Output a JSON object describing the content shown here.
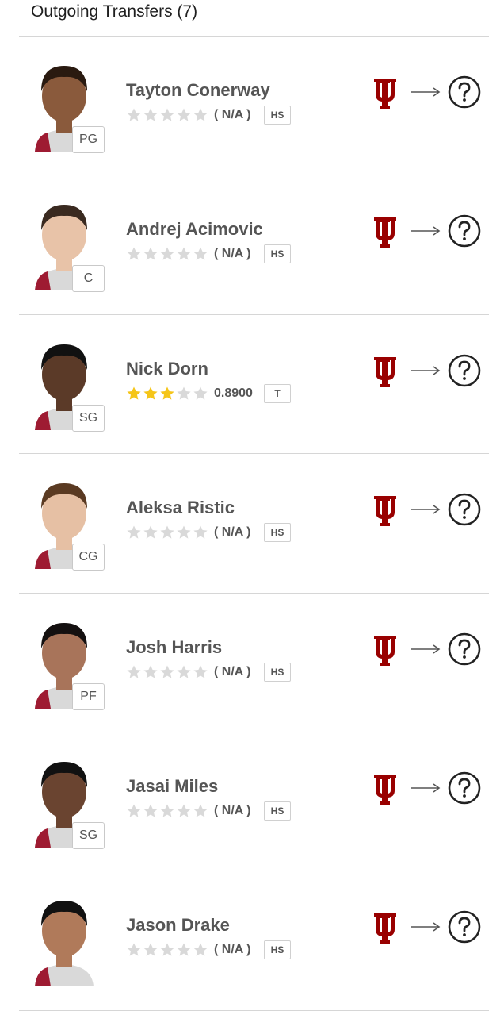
{
  "header": {
    "title": "Outgoing Transfers (7)"
  },
  "transfers": [
    {
      "name": "Tayton Conerway",
      "position": "PG",
      "stars": 0,
      "rating": "( N/A )",
      "tag": "HS"
    },
    {
      "name": "Andrej Acimovic",
      "position": "C",
      "stars": 0,
      "rating": "( N/A )",
      "tag": "HS"
    },
    {
      "name": "Nick Dorn",
      "position": "SG",
      "stars": 3,
      "rating": "0.8900",
      "tag": "T"
    },
    {
      "name": "Aleksa Ristic",
      "position": "CG",
      "stars": 0,
      "rating": "( N/A )",
      "tag": "HS"
    },
    {
      "name": "Josh Harris",
      "position": "PF",
      "stars": 0,
      "rating": "( N/A )",
      "tag": "HS"
    },
    {
      "name": "Jasai Miles",
      "position": "SG",
      "stars": 0,
      "rating": "( N/A )",
      "tag": "HS"
    },
    {
      "name": "Jason Drake",
      "position": "",
      "stars": 0,
      "rating": "( N/A )",
      "tag": "HS"
    }
  ],
  "icons": {
    "school_logo": "indiana-iu-logo",
    "arrow": "right-arrow-icon",
    "destination": "question-mark-icon",
    "star": "star-icon"
  },
  "colors": {
    "iu_crimson": "#990000",
    "star_filled": "#f5c518",
    "star_empty": "#d9d9d9"
  }
}
